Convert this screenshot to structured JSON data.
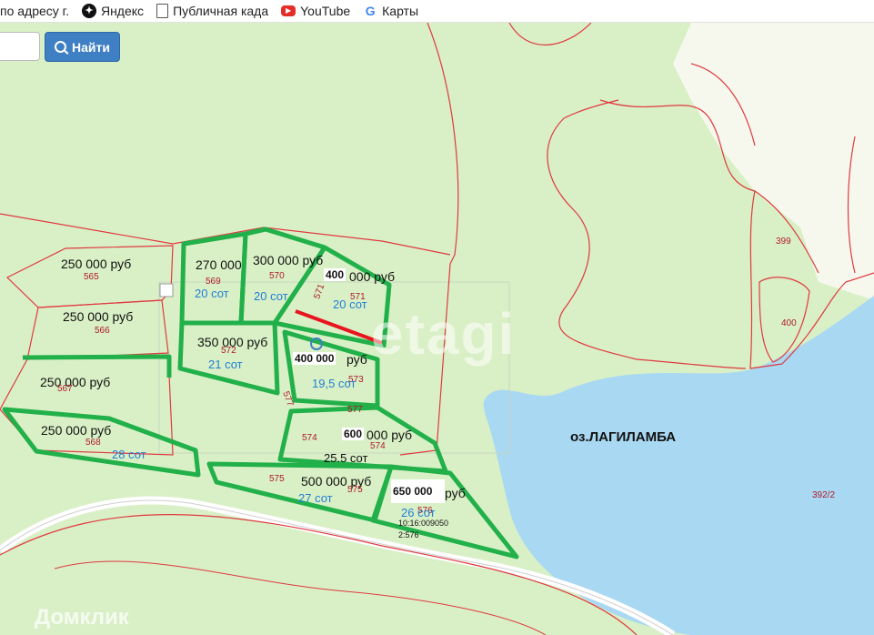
{
  "bookmarks": [
    {
      "label": "по адресу г.",
      "icon": "page-icon"
    },
    {
      "label": "Яндекс",
      "icon": "yandex-icon"
    },
    {
      "label": "Публичная када",
      "icon": "document-icon"
    },
    {
      "label": "YouTube",
      "icon": "youtube-icon"
    },
    {
      "label": "Карты",
      "icon": "google-icon"
    }
  ],
  "search": {
    "placeholder": "",
    "button_label": "Найти",
    "button_icon": "search-icon"
  },
  "labels": {
    "p565_price": "250 000 руб",
    "p565_num": "565",
    "p566_price": "250 000 руб",
    "p566_num": "566",
    "p567_price": "250 000 руб",
    "p567_num": "567",
    "p568_price": "250 000 руб",
    "p568_num": "568",
    "p568_area": "28 сот",
    "p569_price": "270 000",
    "p569_num": "569",
    "p569_area": "20 сот",
    "p570_price": "300 000 руб",
    "p570_num": "570",
    "p570_area": "20 сот",
    "p571_price_bold": "400",
    "p571_price_rest": "000 руб",
    "p571_num": "571",
    "p571_area": "20 сот",
    "p571_side": "571",
    "p572_price": "350 000 руб",
    "p572_num": "572",
    "p572_area": "21 сот",
    "p573_price_bold": "400 000",
    "p573_price_rest": "руб",
    "p573_num": "573",
    "p573_area": "19,5 сот",
    "p577_num": "577",
    "p577_side": "577",
    "p574_num_left": "574",
    "p574_price_bold": "600",
    "p574_price_rest": "000 руб",
    "p574_num": "574",
    "p574_area": "25.5 сот",
    "p575_num": "575",
    "p575_price": "500 000 руб",
    "p575_num2": "575",
    "p575_area": "27 сот",
    "p576_price_bold": "650 000",
    "p576_price_rest": "руб",
    "p576_num": "576",
    "p576_area": "26 сот",
    "cadastral_1": "10:16:009050",
    "cadastral_2": "2:576",
    "p399": "399",
    "p400": "400",
    "p392": "392/2",
    "lake": "оз.ЛАГИЛАМБА",
    "watermark": "etagi",
    "domclick": "Домклик"
  },
  "colors": {
    "land": "#d9f0c6",
    "lake": "#a9d8f2",
    "clearing": "#f6f8ee",
    "cadastral": "#e0393f",
    "selection": "#22b04a",
    "highlight": "#e8141e"
  }
}
